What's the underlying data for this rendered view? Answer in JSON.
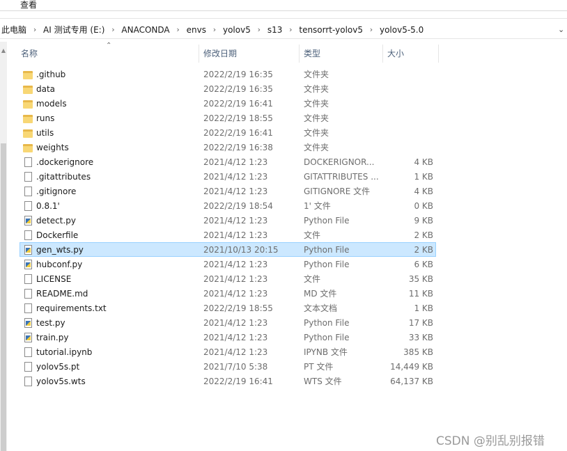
{
  "menu": {
    "view_label": "查看"
  },
  "breadcrumb": [
    "此电脑",
    "AI 测试专用 (E:)",
    "ANACONDA",
    "envs",
    "yolov5",
    "s13",
    "tensorrt-yolov5",
    "yolov5-5.0"
  ],
  "columns": {
    "name": "名称",
    "date": "修改日期",
    "type": "类型",
    "size": "大小"
  },
  "files": [
    {
      "name": ".github",
      "date": "2022/2/19 16:35",
      "type": "文件夹",
      "size": "",
      "icon": "folder-icon"
    },
    {
      "name": "data",
      "date": "2022/2/19 16:35",
      "type": "文件夹",
      "size": "",
      "icon": "folder-icon"
    },
    {
      "name": "models",
      "date": "2022/2/19 16:41",
      "type": "文件夹",
      "size": "",
      "icon": "folder-icon"
    },
    {
      "name": "runs",
      "date": "2022/2/19 18:55",
      "type": "文件夹",
      "size": "",
      "icon": "folder-icon"
    },
    {
      "name": "utils",
      "date": "2022/2/19 16:41",
      "type": "文件夹",
      "size": "",
      "icon": "folder-icon"
    },
    {
      "name": "weights",
      "date": "2022/2/19 16:38",
      "type": "文件夹",
      "size": "",
      "icon": "folder-icon"
    },
    {
      "name": ".dockerignore",
      "date": "2021/4/12 1:23",
      "type": "DOCKERIGNOR...",
      "size": "4 KB",
      "icon": "document-icon"
    },
    {
      "name": ".gitattributes",
      "date": "2021/4/12 1:23",
      "type": "GITATTRIBUTES ...",
      "size": "1 KB",
      "icon": "document-icon"
    },
    {
      "name": ".gitignore",
      "date": "2021/4/12 1:23",
      "type": "GITIGNORE 文件",
      "size": "4 KB",
      "icon": "document-icon"
    },
    {
      "name": "0.8.1'",
      "date": "2022/2/19 18:54",
      "type": "1' 文件",
      "size": "0 KB",
      "icon": "document-icon"
    },
    {
      "name": "detect.py",
      "date": "2021/4/12 1:23",
      "type": "Python File",
      "size": "9 KB",
      "icon": "python-file-icon"
    },
    {
      "name": "Dockerfile",
      "date": "2021/4/12 1:23",
      "type": "文件",
      "size": "2 KB",
      "icon": "document-icon"
    },
    {
      "name": "gen_wts.py",
      "date": "2021/10/13 20:15",
      "type": "Python File",
      "size": "2 KB",
      "icon": "python-file-icon",
      "selected": true
    },
    {
      "name": "hubconf.py",
      "date": "2021/4/12 1:23",
      "type": "Python File",
      "size": "6 KB",
      "icon": "python-file-icon"
    },
    {
      "name": "LICENSE",
      "date": "2021/4/12 1:23",
      "type": "文件",
      "size": "35 KB",
      "icon": "document-icon"
    },
    {
      "name": "README.md",
      "date": "2021/4/12 1:23",
      "type": "MD 文件",
      "size": "11 KB",
      "icon": "document-icon"
    },
    {
      "name": "requirements.txt",
      "date": "2022/2/19 18:55",
      "type": "文本文档",
      "size": "1 KB",
      "icon": "document-icon"
    },
    {
      "name": "test.py",
      "date": "2021/4/12 1:23",
      "type": "Python File",
      "size": "17 KB",
      "icon": "python-file-icon"
    },
    {
      "name": "train.py",
      "date": "2021/4/12 1:23",
      "type": "Python File",
      "size": "33 KB",
      "icon": "python-file-icon"
    },
    {
      "name": "tutorial.ipynb",
      "date": "2021/4/12 1:23",
      "type": "IPYNB 文件",
      "size": "385 KB",
      "icon": "document-icon"
    },
    {
      "name": "yolov5s.pt",
      "date": "2021/7/10 5:38",
      "type": "PT 文件",
      "size": "14,449 KB",
      "icon": "document-icon"
    },
    {
      "name": "yolov5s.wts",
      "date": "2022/2/19 16:41",
      "type": "WTS 文件",
      "size": "64,137 KB",
      "icon": "document-icon"
    }
  ],
  "watermark": "CSDN @别乱别报错",
  "colors": {
    "selection_bg": "#cce8ff",
    "selection_border": "#99d1ff",
    "folder": "#f8d775"
  }
}
